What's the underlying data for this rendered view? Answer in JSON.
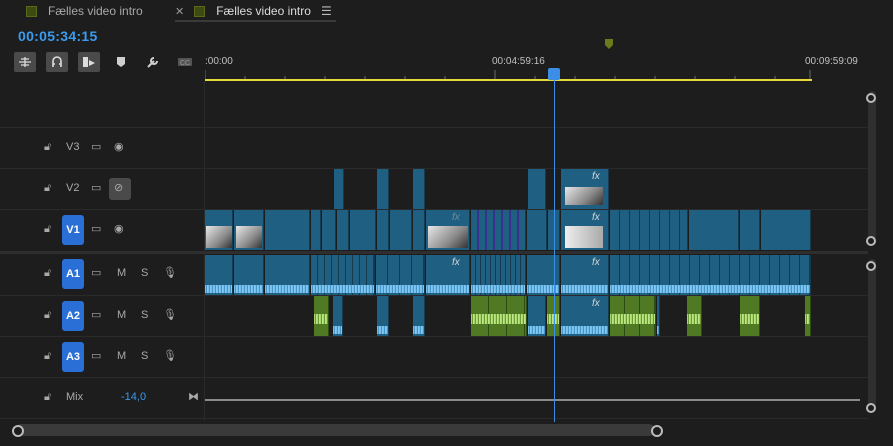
{
  "tabs": [
    {
      "label": "Fælles video intro",
      "active": false
    },
    {
      "label": "Fælles video intro",
      "active": true
    }
  ],
  "timecode": "00:05:34:15",
  "ruler": {
    "start": ":00:00",
    "middle": "00:04:59:16",
    "end": "00:09:59:09"
  },
  "tracks": {
    "video": [
      {
        "name": "V3",
        "targeted": false,
        "eye_disabled": false
      },
      {
        "name": "V2",
        "targeted": false,
        "eye_disabled": true
      },
      {
        "name": "V1",
        "targeted": true,
        "eye_disabled": false
      }
    ],
    "audio": [
      {
        "name": "A1",
        "targeted": true,
        "mute": "M",
        "solo": "S"
      },
      {
        "name": "A2",
        "targeted": true,
        "mute": "M",
        "solo": "S"
      },
      {
        "name": "A3",
        "targeted": true,
        "mute": "M",
        "solo": "S"
      }
    ],
    "mix": {
      "label": "Mix",
      "value": "-14,0"
    }
  },
  "clip_label": "fx",
  "colors": {
    "accent": "#3a9bef",
    "video_clip": "#1f5f82",
    "audio_clip_green": "#4f7a23",
    "work_area": "#e6d73a",
    "track_target": "#2a6fd6"
  },
  "icons": {
    "snap": "snap-icon",
    "linked": "linked-selection-icon",
    "marker": "marker-icon",
    "wrench": "wrench-icon",
    "captions": "captions-icon"
  }
}
